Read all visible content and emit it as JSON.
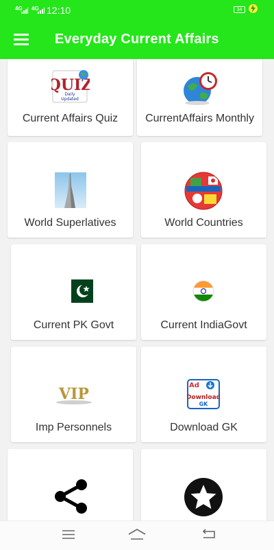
{
  "status": {
    "signal1": "4G",
    "signal2": "4G",
    "time": "12:10",
    "battery": "34"
  },
  "appbar": {
    "title": "Everyday Current Affairs",
    "menu_icon": "hamburger-menu-icon",
    "color": "#24e61a"
  },
  "cards": [
    {
      "label": "Current Affairs Quiz",
      "icon": "quiz-icon"
    },
    {
      "label": "CurrentAffairs Monthly",
      "icon": "globe-clock-icon"
    },
    {
      "label": "World Superlatives",
      "icon": "tower-icon"
    },
    {
      "label": "World Countries",
      "icon": "flags-globe-icon"
    },
    {
      "label": "Current PK Govt",
      "icon": "pakistan-flag-icon"
    },
    {
      "label": "Current IndiaGovt",
      "icon": "india-flag-icon"
    },
    {
      "label": "Imp Personnels",
      "icon": "vip-icon"
    },
    {
      "label": "Download GK",
      "icon": "download-gk-icon"
    },
    {
      "label": "",
      "icon": "share-icon"
    },
    {
      "label": "",
      "icon": "star-icon"
    }
  ],
  "quiz_icon": {
    "word": "QUIZ",
    "line1": "Daily",
    "line2": "Updated"
  },
  "vip_icon": {
    "text": "VIP"
  },
  "download_icon": {
    "ad": "Ad",
    "line1": "Download",
    "line2": "GK"
  },
  "navbar": {
    "icons": [
      "menu-lines-icon",
      "home-icon",
      "back-icon"
    ]
  }
}
